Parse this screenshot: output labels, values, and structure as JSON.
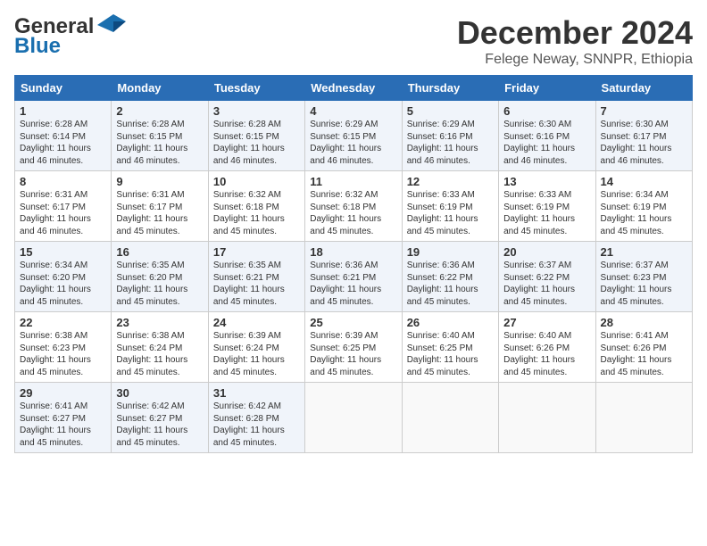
{
  "header": {
    "logo_general": "General",
    "logo_blue": "Blue",
    "title": "December 2024",
    "subtitle": "Felege Neway, SNNPR, Ethiopia"
  },
  "columns": [
    "Sunday",
    "Monday",
    "Tuesday",
    "Wednesday",
    "Thursday",
    "Friday",
    "Saturday"
  ],
  "rows": [
    [
      {
        "day": "1",
        "lines": [
          "Sunrise: 6:28 AM",
          "Sunset: 6:14 PM",
          "Daylight: 11 hours",
          "and 46 minutes."
        ]
      },
      {
        "day": "2",
        "lines": [
          "Sunrise: 6:28 AM",
          "Sunset: 6:15 PM",
          "Daylight: 11 hours",
          "and 46 minutes."
        ]
      },
      {
        "day": "3",
        "lines": [
          "Sunrise: 6:28 AM",
          "Sunset: 6:15 PM",
          "Daylight: 11 hours",
          "and 46 minutes."
        ]
      },
      {
        "day": "4",
        "lines": [
          "Sunrise: 6:29 AM",
          "Sunset: 6:15 PM",
          "Daylight: 11 hours",
          "and 46 minutes."
        ]
      },
      {
        "day": "5",
        "lines": [
          "Sunrise: 6:29 AM",
          "Sunset: 6:16 PM",
          "Daylight: 11 hours",
          "and 46 minutes."
        ]
      },
      {
        "day": "6",
        "lines": [
          "Sunrise: 6:30 AM",
          "Sunset: 6:16 PM",
          "Daylight: 11 hours",
          "and 46 minutes."
        ]
      },
      {
        "day": "7",
        "lines": [
          "Sunrise: 6:30 AM",
          "Sunset: 6:17 PM",
          "Daylight: 11 hours",
          "and 46 minutes."
        ]
      }
    ],
    [
      {
        "day": "8",
        "lines": [
          "Sunrise: 6:31 AM",
          "Sunset: 6:17 PM",
          "Daylight: 11 hours",
          "and 46 minutes."
        ]
      },
      {
        "day": "9",
        "lines": [
          "Sunrise: 6:31 AM",
          "Sunset: 6:17 PM",
          "Daylight: 11 hours",
          "and 45 minutes."
        ]
      },
      {
        "day": "10",
        "lines": [
          "Sunrise: 6:32 AM",
          "Sunset: 6:18 PM",
          "Daylight: 11 hours",
          "and 45 minutes."
        ]
      },
      {
        "day": "11",
        "lines": [
          "Sunrise: 6:32 AM",
          "Sunset: 6:18 PM",
          "Daylight: 11 hours",
          "and 45 minutes."
        ]
      },
      {
        "day": "12",
        "lines": [
          "Sunrise: 6:33 AM",
          "Sunset: 6:19 PM",
          "Daylight: 11 hours",
          "and 45 minutes."
        ]
      },
      {
        "day": "13",
        "lines": [
          "Sunrise: 6:33 AM",
          "Sunset: 6:19 PM",
          "Daylight: 11 hours",
          "and 45 minutes."
        ]
      },
      {
        "day": "14",
        "lines": [
          "Sunrise: 6:34 AM",
          "Sunset: 6:19 PM",
          "Daylight: 11 hours",
          "and 45 minutes."
        ]
      }
    ],
    [
      {
        "day": "15",
        "lines": [
          "Sunrise: 6:34 AM",
          "Sunset: 6:20 PM",
          "Daylight: 11 hours",
          "and 45 minutes."
        ]
      },
      {
        "day": "16",
        "lines": [
          "Sunrise: 6:35 AM",
          "Sunset: 6:20 PM",
          "Daylight: 11 hours",
          "and 45 minutes."
        ]
      },
      {
        "day": "17",
        "lines": [
          "Sunrise: 6:35 AM",
          "Sunset: 6:21 PM",
          "Daylight: 11 hours",
          "and 45 minutes."
        ]
      },
      {
        "day": "18",
        "lines": [
          "Sunrise: 6:36 AM",
          "Sunset: 6:21 PM",
          "Daylight: 11 hours",
          "and 45 minutes."
        ]
      },
      {
        "day": "19",
        "lines": [
          "Sunrise: 6:36 AM",
          "Sunset: 6:22 PM",
          "Daylight: 11 hours",
          "and 45 minutes."
        ]
      },
      {
        "day": "20",
        "lines": [
          "Sunrise: 6:37 AM",
          "Sunset: 6:22 PM",
          "Daylight: 11 hours",
          "and 45 minutes."
        ]
      },
      {
        "day": "21",
        "lines": [
          "Sunrise: 6:37 AM",
          "Sunset: 6:23 PM",
          "Daylight: 11 hours",
          "and 45 minutes."
        ]
      }
    ],
    [
      {
        "day": "22",
        "lines": [
          "Sunrise: 6:38 AM",
          "Sunset: 6:23 PM",
          "Daylight: 11 hours",
          "and 45 minutes."
        ]
      },
      {
        "day": "23",
        "lines": [
          "Sunrise: 6:38 AM",
          "Sunset: 6:24 PM",
          "Daylight: 11 hours",
          "and 45 minutes."
        ]
      },
      {
        "day": "24",
        "lines": [
          "Sunrise: 6:39 AM",
          "Sunset: 6:24 PM",
          "Daylight: 11 hours",
          "and 45 minutes."
        ]
      },
      {
        "day": "25",
        "lines": [
          "Sunrise: 6:39 AM",
          "Sunset: 6:25 PM",
          "Daylight: 11 hours",
          "and 45 minutes."
        ]
      },
      {
        "day": "26",
        "lines": [
          "Sunrise: 6:40 AM",
          "Sunset: 6:25 PM",
          "Daylight: 11 hours",
          "and 45 minutes."
        ]
      },
      {
        "day": "27",
        "lines": [
          "Sunrise: 6:40 AM",
          "Sunset: 6:26 PM",
          "Daylight: 11 hours",
          "and 45 minutes."
        ]
      },
      {
        "day": "28",
        "lines": [
          "Sunrise: 6:41 AM",
          "Sunset: 6:26 PM",
          "Daylight: 11 hours",
          "and 45 minutes."
        ]
      }
    ],
    [
      {
        "day": "29",
        "lines": [
          "Sunrise: 6:41 AM",
          "Sunset: 6:27 PM",
          "Daylight: 11 hours",
          "and 45 minutes."
        ]
      },
      {
        "day": "30",
        "lines": [
          "Sunrise: 6:42 AM",
          "Sunset: 6:27 PM",
          "Daylight: 11 hours",
          "and 45 minutes."
        ]
      },
      {
        "day": "31",
        "lines": [
          "Sunrise: 6:42 AM",
          "Sunset: 6:28 PM",
          "Daylight: 11 hours",
          "and 45 minutes."
        ]
      },
      null,
      null,
      null,
      null
    ]
  ]
}
